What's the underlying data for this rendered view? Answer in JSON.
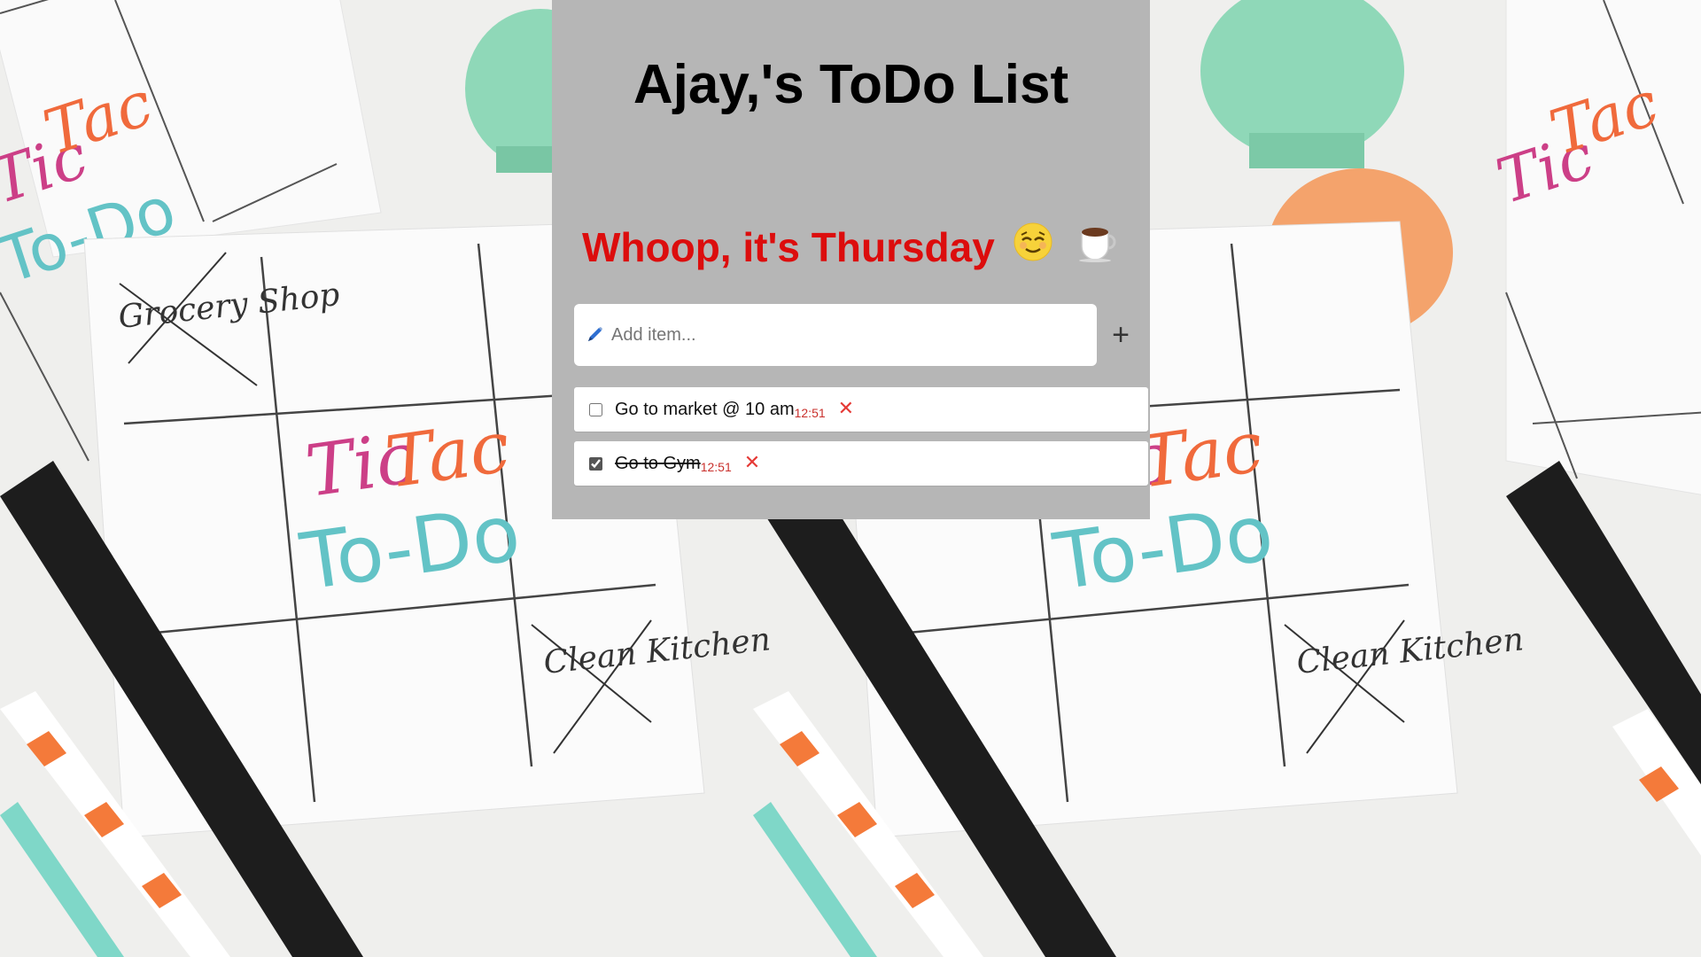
{
  "header": {
    "title": "Ajay,'s ToDo List",
    "greeting": "Whoop, it's Thursday",
    "greeting_emojis": [
      "😌",
      "☕"
    ]
  },
  "add_item": {
    "placeholder": "Add item...",
    "button_label": "+"
  },
  "todos": [
    {
      "text": "Go to market @ 10 am",
      "time": "12:51",
      "done": false,
      "delete_label": "✕"
    },
    {
      "text": "Go to Gym",
      "time": "12:51",
      "done": true,
      "delete_label": "✕"
    }
  ],
  "colors": {
    "panel_bg": "#b6b6b6",
    "greeting": "#dc0d0d",
    "time": "#c9302c",
    "delete": "#e53935"
  },
  "background": {
    "card_title_1": "Tic",
    "card_title_2": "Tac",
    "card_title_3": "To-Do",
    "note_1": "Grocery Shop",
    "note_2": "Clean Kitchen"
  }
}
